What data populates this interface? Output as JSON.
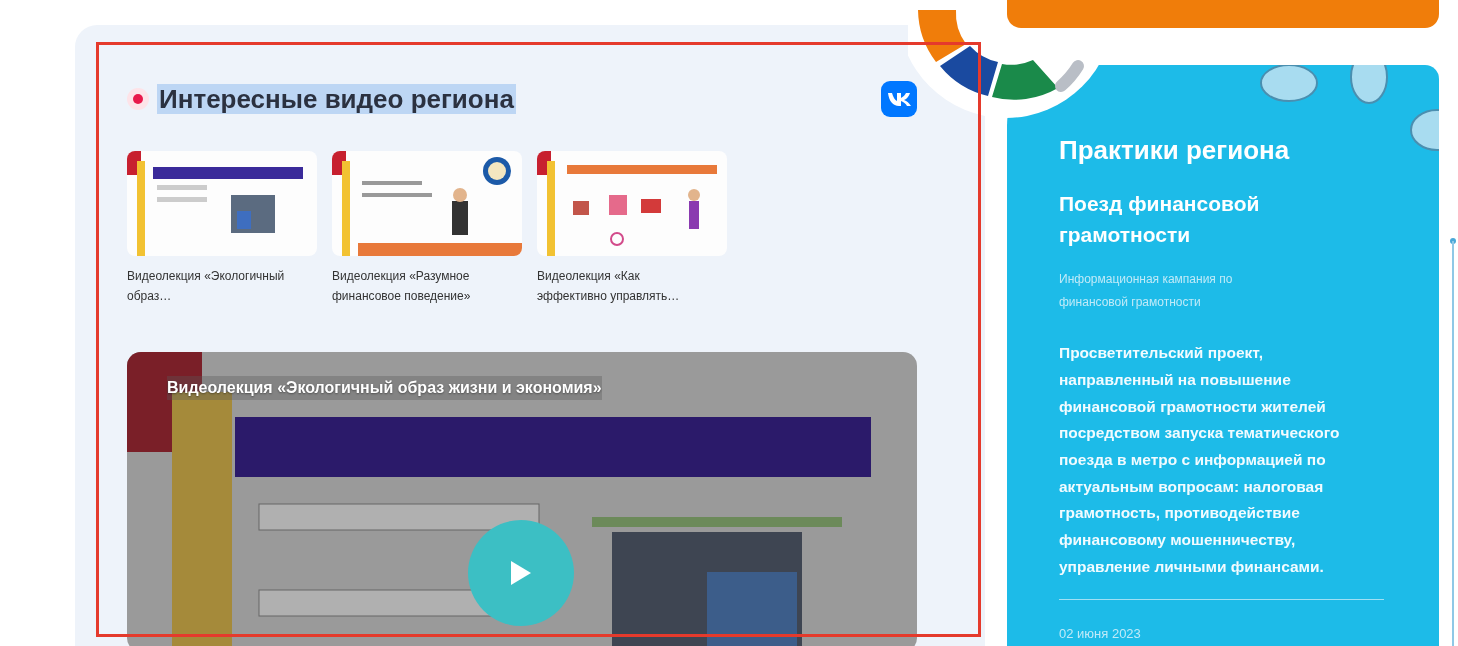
{
  "videos_section": {
    "title": "Интересные видео региона",
    "title_text_selected": true,
    "thumbnails": [
      {
        "caption": "Видеолекция «Экологичный образ…",
        "kind": "picture"
      },
      {
        "caption": "Видеолекция «Разумное финансовое поведение»",
        "kind": "picture"
      },
      {
        "caption": "Видеолекция «Как эффективно управлять…",
        "kind": "picture"
      }
    ],
    "player": {
      "title": "Видеолекция «Экологичный образ жизни и экономия»",
      "kind": "picture"
    }
  },
  "practices_card": {
    "title": "Практики региона",
    "practice_title": "Поезд финансовой грамотности",
    "category": "Информационная кампания по финансовой грамотности",
    "description": "Просветительский проект, направленный на повышение финансовой грамотности жителей посредством запуска тематического поезда в метро с информацией по актуальным вопросам: налоговая грамотность, противодействие финансовому мошенничеству, управление личными финансами.",
    "date": "02 июня 2023"
  }
}
